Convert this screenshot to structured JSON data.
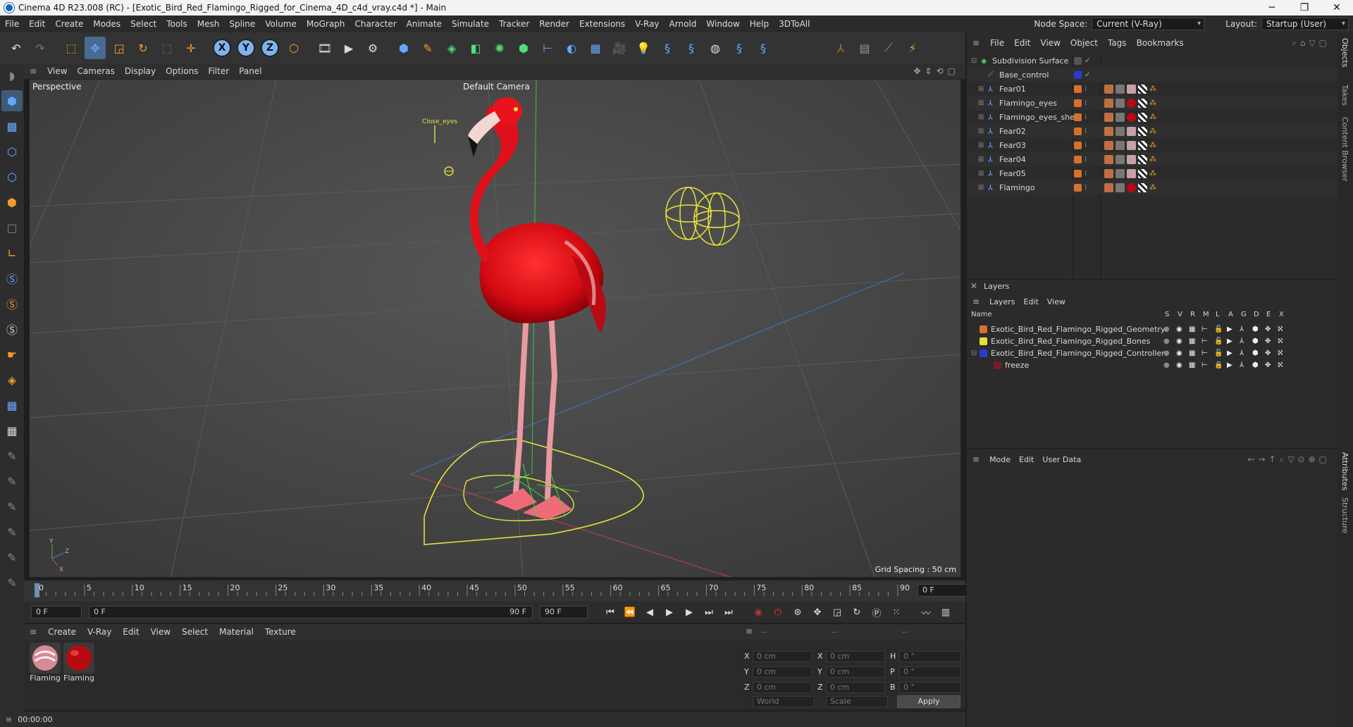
{
  "window": {
    "title": "Cinema 4D R23.008 (RC) - [Exotic_Bird_Red_Flamingo_Rigged_for_Cinema_4D_c4d_vray.c4d *] - Main",
    "minimize": "─",
    "maximize": "❐",
    "close": "✕"
  },
  "menu": {
    "items": [
      "File",
      "Edit",
      "Create",
      "Modes",
      "Select",
      "Tools",
      "Mesh",
      "Spline",
      "Volume",
      "MoGraph",
      "Character",
      "Animate",
      "Simulate",
      "Tracker",
      "Render",
      "Extensions",
      "V-Ray",
      "Arnold",
      "Window",
      "Help",
      "3DToAll"
    ],
    "node_space_label": "Node Space:",
    "node_space_value": "Current (V-Ray)",
    "layout_label": "Layout:",
    "layout_value": "Startup (User)"
  },
  "viewport": {
    "menu": [
      "View",
      "Cameras",
      "Display",
      "Options",
      "Filter",
      "Panel"
    ],
    "label": "Perspective",
    "camera": "Default Camera",
    "grid_spacing": "Grid Spacing : 50 cm",
    "annotation": "Close_eyes",
    "axis_y": "Y",
    "axis_z": "Z",
    "axis_x": "X"
  },
  "timeline": {
    "ticks": [
      "0",
      "5",
      "10",
      "15",
      "20",
      "25",
      "30",
      "35",
      "40",
      "45",
      "50",
      "55",
      "60",
      "65",
      "70",
      "75",
      "80",
      "85",
      "90"
    ],
    "current_frame": "0 F"
  },
  "transport": {
    "start": "0 F",
    "range_start": "0 F",
    "range_end": "90 F",
    "end": "90 F"
  },
  "materials": {
    "menu": [
      "Create",
      "V-Ray",
      "Edit",
      "View",
      "Select",
      "Material",
      "Texture"
    ],
    "items": [
      "Flaming",
      "Flaming"
    ]
  },
  "coords": {
    "header": [
      "--",
      "--",
      "--"
    ],
    "labels": [
      "X",
      "Y",
      "Z",
      "X",
      "Y",
      "Z",
      "H",
      "P",
      "B"
    ],
    "values": [
      "0 cm",
      "0 cm",
      "0 cm",
      "0 cm",
      "0 cm",
      "0 cm",
      "0 °",
      "0 °",
      "0 °"
    ],
    "world": "World",
    "scale": "Scale",
    "apply": "Apply"
  },
  "status": {
    "time": "00:00:00"
  },
  "objects": {
    "menu": [
      "File",
      "Edit",
      "View",
      "Object",
      "Tags",
      "Bookmarks"
    ],
    "rows": [
      {
        "name": "Subdivision Surface"
      },
      {
        "name": "Base_control"
      },
      {
        "name": "Fear01"
      },
      {
        "name": "Flamingo_eyes"
      },
      {
        "name": "Flamingo_eyes_shell"
      },
      {
        "name": "Fear02"
      },
      {
        "name": "Fear03"
      },
      {
        "name": "Fear04"
      },
      {
        "name": "Fear05"
      },
      {
        "name": "Flamingo"
      }
    ]
  },
  "layers": {
    "title": "Layers",
    "menu": [
      "Layers",
      "Edit",
      "View"
    ],
    "col_name": "Name",
    "cols": [
      "S",
      "V",
      "R",
      "M",
      "L",
      "A",
      "G",
      "D",
      "E",
      "X"
    ],
    "rows": [
      {
        "name": "Exotic_Bird_Red_Flamingo_Rigged_Geometry",
        "color": "#d9702a"
      },
      {
        "name": "Exotic_Bird_Red_Flamingo_Rigged_Bones",
        "color": "#e8e03a"
      },
      {
        "name": "Exotic_Bird_Red_Flamingo_Rigged_Controllers",
        "color": "#2b3bd0"
      },
      {
        "name": "freeze",
        "color": "#7a1a2a"
      }
    ]
  },
  "attributes": {
    "menu": [
      "Mode",
      "Edit",
      "User Data"
    ]
  },
  "right_tabs": [
    "Objects",
    "Takes",
    "Content Browser",
    "Attributes",
    "Structure"
  ]
}
